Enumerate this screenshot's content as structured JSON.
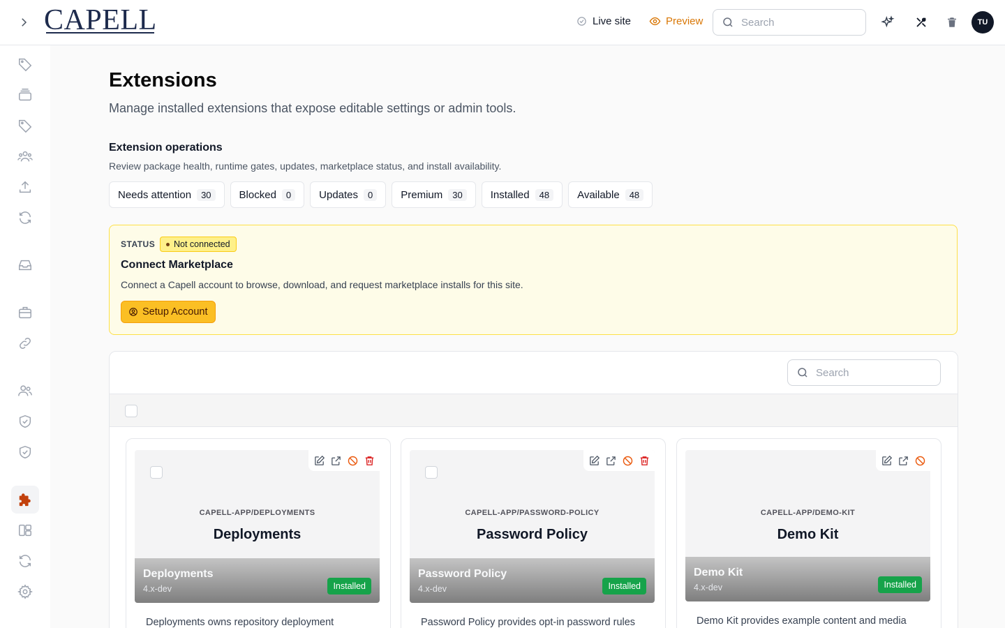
{
  "brand": {
    "logo_text": "CAPELL"
  },
  "header": {
    "live_site_label": "Live site",
    "preview_label": "Preview",
    "search_placeholder": "Search",
    "avatar_initials": "TU",
    "accent_color": "#d97706"
  },
  "sidebar": {
    "icons": [
      "tag-icon",
      "stack-icon",
      "tag-icon",
      "users-group-icon",
      "upload-icon",
      "refresh-icon",
      "inbox-icon",
      "briefcase-icon",
      "link-icon",
      "users-icon",
      "shield-check-icon",
      "shield-check-icon",
      "puzzle-icon",
      "layout-icon",
      "refresh-icon",
      "gear-icon"
    ],
    "active": "puzzle-icon"
  },
  "page": {
    "title": "Extensions",
    "subtitle": "Manage installed extensions that expose editable settings or admin tools."
  },
  "operations": {
    "title": "Extension operations",
    "subtitle": "Review package health, runtime gates, updates, marketplace status, and install availability.",
    "chips": [
      {
        "label": "Needs attention",
        "count": "30"
      },
      {
        "label": "Blocked",
        "count": "0"
      },
      {
        "label": "Updates",
        "count": "0"
      },
      {
        "label": "Premium",
        "count": "30"
      },
      {
        "label": "Installed",
        "count": "48"
      },
      {
        "label": "Available",
        "count": "48"
      }
    ]
  },
  "marketplace": {
    "status_label": "STATUS",
    "status_value": "Not connected",
    "title": "Connect Marketplace",
    "description": "Connect a Capell account to browse, download, and request marketplace installs for this site.",
    "button_label": "Setup Account",
    "bg_color": "#fefce8",
    "button_color": "#fbbf24"
  },
  "list": {
    "search_placeholder": "Search",
    "cards": [
      {
        "package": "CAPELL-APP/DEPLOYMENTS",
        "name": "Deployments",
        "version": "4.x-dev",
        "status": "Installed",
        "description": "Deployments owns repository deployment",
        "deletable": true
      },
      {
        "package": "CAPELL-APP/PASSWORD-POLICY",
        "name": "Password Policy",
        "version": "4.x-dev",
        "status": "Installed",
        "description": "Password Policy provides opt-in password rules",
        "deletable": true
      },
      {
        "package": "CAPELL-APP/DEMO-KIT",
        "name": "Demo Kit",
        "version": "4.x-dev",
        "status": "Installed",
        "description": "Demo Kit provides example content and media",
        "deletable": false
      }
    ],
    "installed_color": "#16a34a"
  }
}
